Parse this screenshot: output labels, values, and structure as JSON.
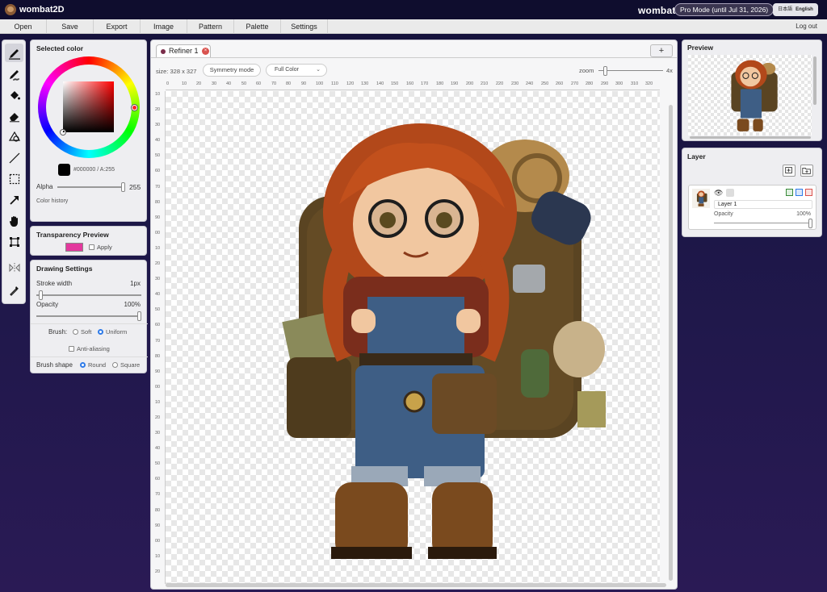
{
  "app": {
    "title": "wombat2D",
    "brand": "wombat",
    "pro_badge": "Pro Mode (until Jul 31, 2026)",
    "lang_ja": "日本語",
    "lang_en": "English"
  },
  "menu": {
    "items": [
      "Open",
      "Save",
      "Export",
      "Image",
      "Pattern",
      "Palette",
      "Settings"
    ],
    "logout": "Log out"
  },
  "tools": [
    "pen-icon",
    "pattern-brush-icon",
    "fill-bucket-icon",
    "eraser-icon",
    "shape-icon",
    "line-icon",
    "selection-icon",
    "arrow-icon",
    "hand-icon",
    "transform-icon",
    "mirror-icon",
    "eyedropper-icon"
  ],
  "color_panel": {
    "title": "Selected color",
    "value": "#000000 / A:255",
    "alpha_label": "Alpha",
    "alpha_value": "255",
    "alpha_fraction": 1.0,
    "history_label": "Color history",
    "swatch_color": "#000000"
  },
  "transparency": {
    "title": "Transparency Preview",
    "apply_label": "Apply",
    "swatch_color": "#e3399e"
  },
  "drawing": {
    "title": "Drawing Settings",
    "stroke_label": "Stroke width",
    "stroke_value": "1px",
    "stroke_fraction": 0.02,
    "opacity_label": "Opacity",
    "opacity_value": "100%",
    "opacity_fraction": 1.0,
    "brush_label": "Brush:",
    "brush_soft": "Soft",
    "brush_uniform": "Uniform",
    "anti_aliasing": "Anti-aliasing",
    "shape_label": "Brush shape",
    "shape_round": "Round",
    "shape_square": "Square"
  },
  "canvas": {
    "tab_label": "Refiner 1",
    "add_tab": "+",
    "size_text": "size: 328 x 327",
    "symmetry_label": "Symmetry mode",
    "color_mode": "Full Color",
    "zoom_label": "zoom",
    "zoom_value": "4x",
    "ruler_top": [
      "0",
      "10",
      "20",
      "30",
      "40",
      "50",
      "60",
      "70",
      "80",
      "90",
      "100",
      "110",
      "120",
      "130",
      "140",
      "150",
      "160",
      "170",
      "180",
      "190",
      "200",
      "210",
      "220",
      "230",
      "240",
      "250",
      "260",
      "270",
      "280",
      "290",
      "300",
      "310",
      "320"
    ],
    "ruler_left": [
      "10",
      "20",
      "30",
      "40",
      "50",
      "60",
      "70",
      "80",
      "90",
      "00",
      "10",
      "20",
      "30",
      "40",
      "50",
      "60",
      "70",
      "80",
      "90",
      "00",
      "10",
      "20",
      "30",
      "40",
      "50",
      "60",
      "70",
      "80",
      "90",
      "00",
      "10",
      "20"
    ]
  },
  "preview": {
    "title": "Preview"
  },
  "layers": {
    "title": "Layer",
    "name": "Layer 1",
    "opacity_label": "Opacity",
    "opacity_value": "100%",
    "opacity_fraction": 1.0
  },
  "colors": {
    "accent_badge": "#3a3550",
    "tab_dot": "#7a2d4a",
    "hair": "#c2501c",
    "denim": "#3e5e85",
    "pack": "#5a4422"
  }
}
